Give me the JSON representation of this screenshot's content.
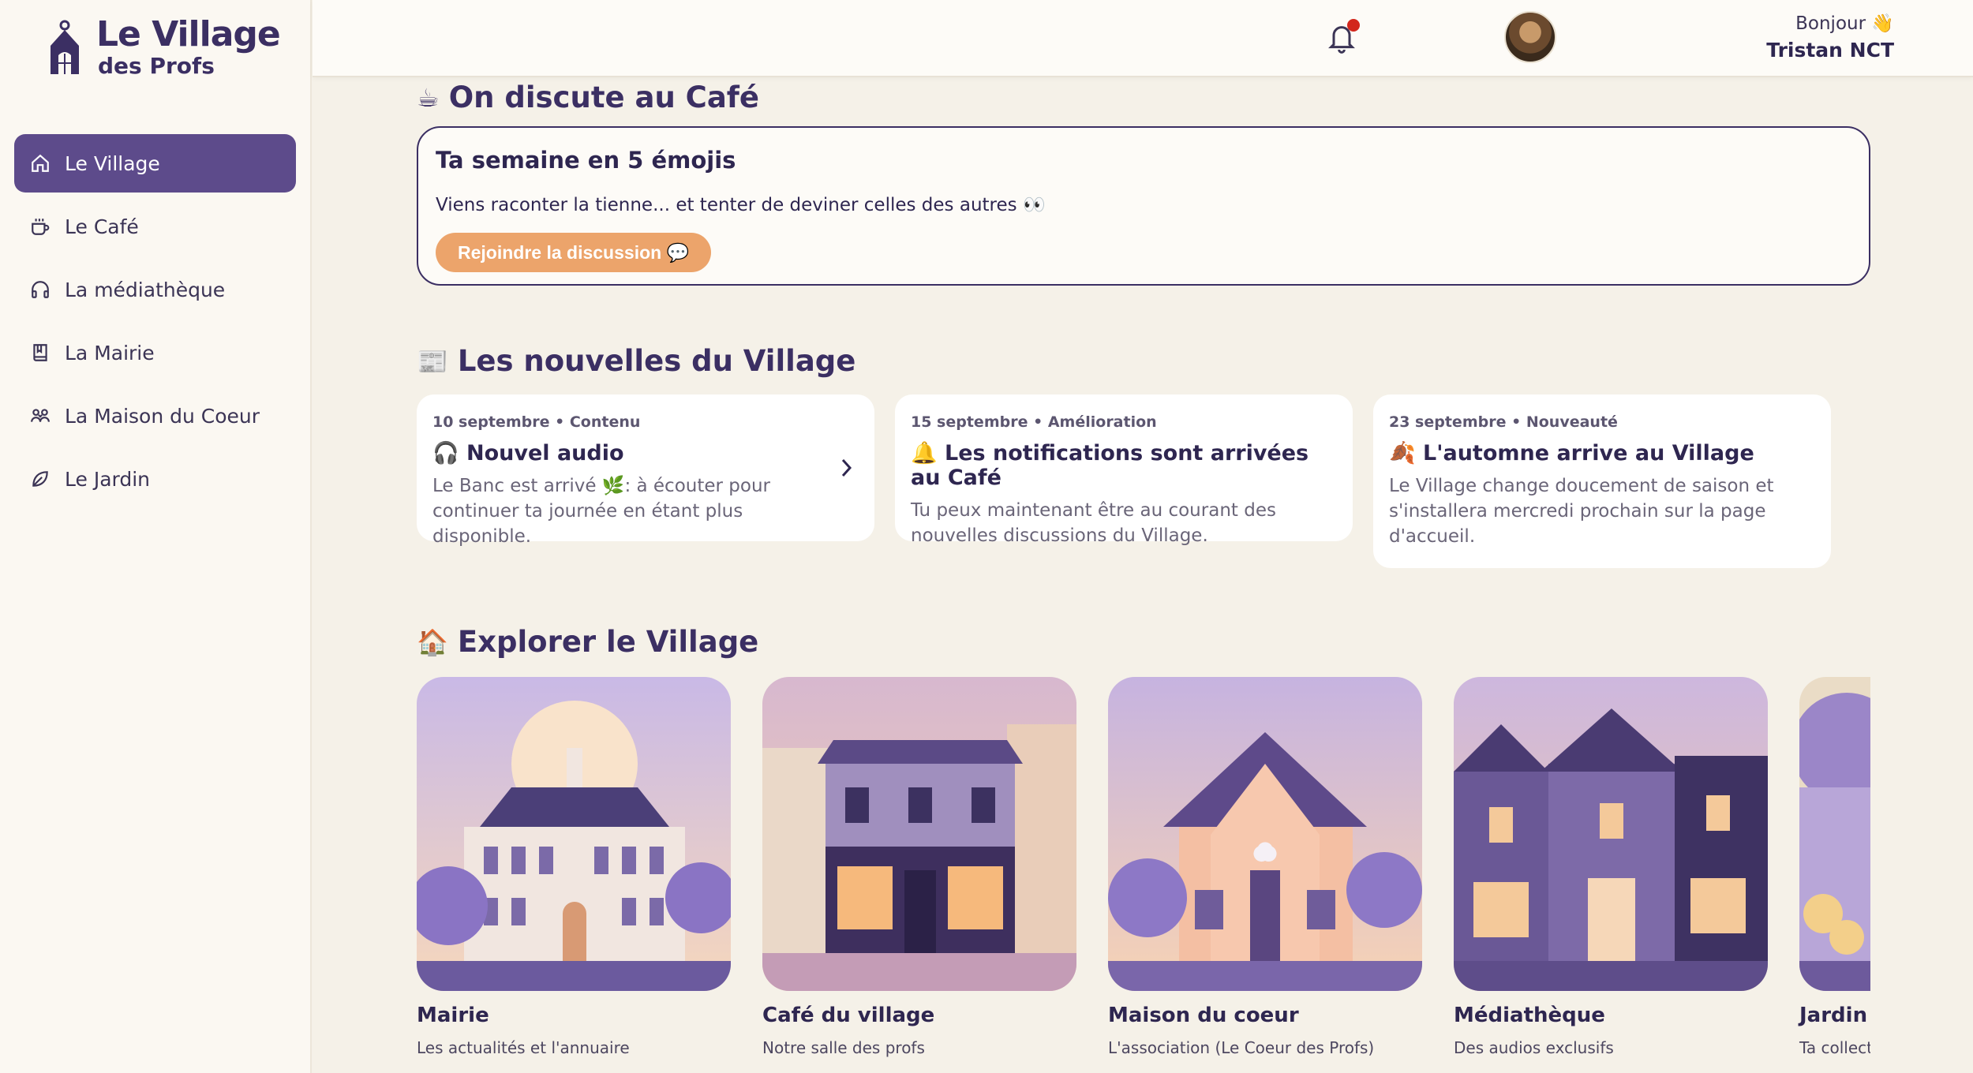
{
  "brand": {
    "title": "Le Village",
    "subtitle": "des Profs"
  },
  "sidebar": {
    "items": [
      {
        "label": "Le Village",
        "icon": "home-icon",
        "active": true
      },
      {
        "label": "Le Café",
        "icon": "coffee-cup-icon"
      },
      {
        "label": "La médiathèque",
        "icon": "headphones-icon"
      },
      {
        "label": "La Mairie",
        "icon": "book-icon"
      },
      {
        "label": "La Maison du Coeur",
        "icon": "people-icon"
      },
      {
        "label": "Le Jardin",
        "icon": "leaf-icon"
      }
    ]
  },
  "header": {
    "greeting": "Bonjour 👋",
    "user_name": "Tristan NCT",
    "has_notification": true
  },
  "cafe": {
    "section_title": "On discute au Café",
    "section_emoji": "☕",
    "card_title": "Ta semaine en 5 émojis",
    "card_text": "Viens raconter la tienne... et tenter de deviner celles des autres 👀",
    "button_label": "Rejoindre la discussion 💬"
  },
  "news": {
    "section_title": "Les nouvelles du Village",
    "section_emoji": "📰",
    "items": [
      {
        "meta": "10 septembre • Contenu",
        "title": "🎧 Nouvel audio",
        "body": "Le Banc est arrivé 🌿: à écouter pour continuer ta journée en étant plus disponible."
      },
      {
        "meta": "15 septembre • Amélioration",
        "title": "🔔 Les notifications sont arrivées au Café",
        "body": "Tu peux maintenant être au courant des nouvelles discussions du Village."
      },
      {
        "meta": "23 septembre • Nouveauté",
        "title": "🍂 L'automne arrive au Village",
        "body": "Le Village change doucement de saison et s'installera mercredi prochain sur la page d'accueil."
      }
    ]
  },
  "explore": {
    "section_title": "Explorer le Village",
    "section_emoji": "🏠",
    "places": [
      {
        "name": "Mairie",
        "desc": "Les actualités et l'annuaire"
      },
      {
        "name": "Café du village",
        "desc": "Notre salle des profs"
      },
      {
        "name": "Maison du coeur",
        "desc": "L'association (Le Coeur des Profs)"
      },
      {
        "name": "Médiathèque",
        "desc": "Des audios exclusifs"
      },
      {
        "name": "Jardin",
        "desc": "Ta collection"
      }
    ]
  },
  "colors": {
    "accent": "#5d4b8b",
    "button": "#eca46b",
    "background": "#f5f1e8",
    "text": "#2e2650"
  }
}
